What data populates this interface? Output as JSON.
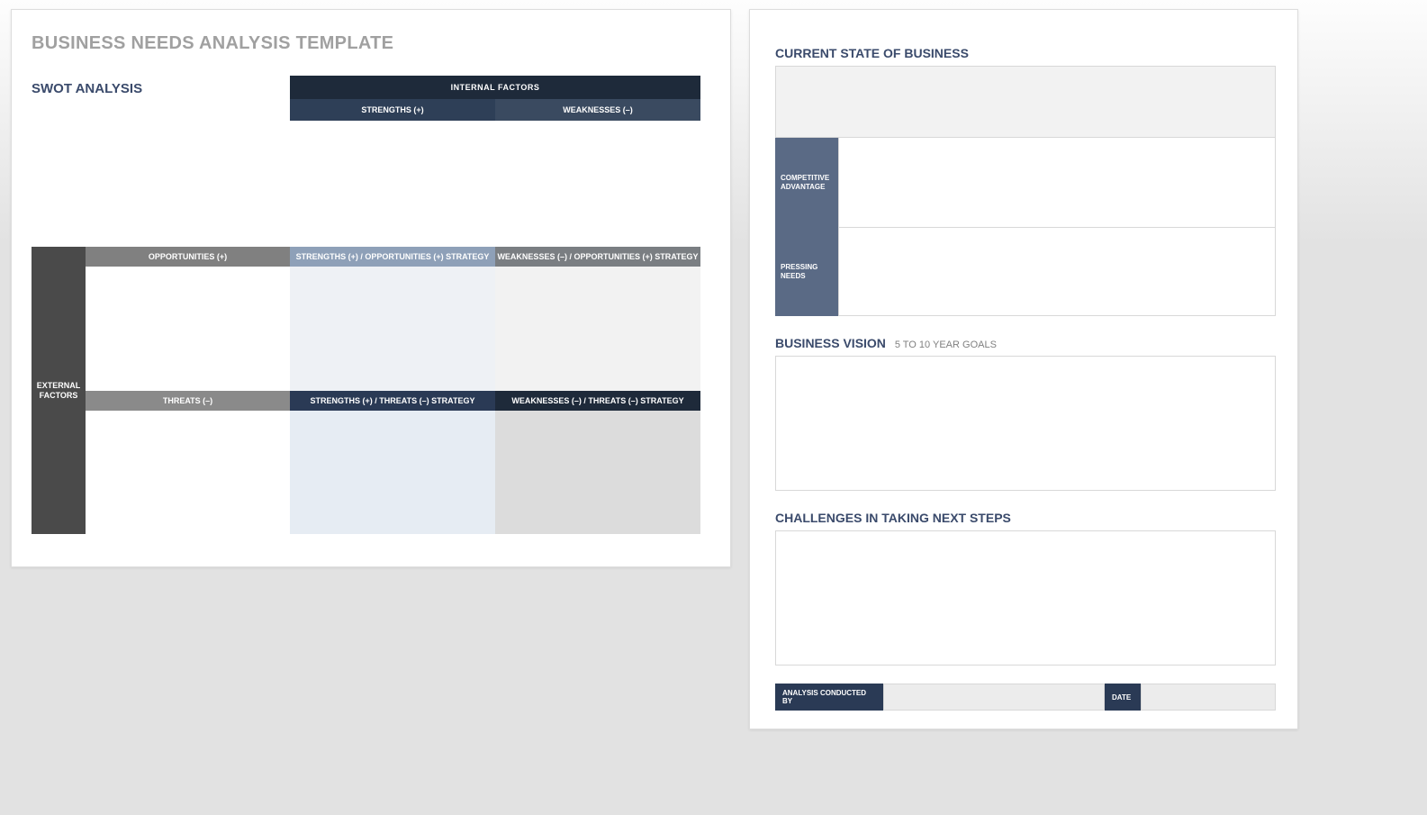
{
  "left": {
    "title": "BUSINESS NEEDS ANALYSIS TEMPLATE",
    "swot_label": "SWOT ANALYSIS",
    "internal_factors": "INTERNAL    FACTORS",
    "external_factors": "EXTERNAL FACTORS",
    "strengths": "STRENGTHS (+)",
    "weaknesses": "WEAKNESSES (–)",
    "opportunities": "OPPORTUNITIES (+)",
    "threats": "THREATS (–)",
    "so_strategy": "STRENGTHS (+) / OPPORTUNITIES (+) STRATEGY",
    "wo_strategy": "WEAKNESSES (–) / OPPORTUNITIES (+) STRATEGY",
    "st_strategy": "STRENGTHS (+) / THREATS (–) STRATEGY",
    "wt_strategy": "WEAKNESSES (–) / THREATS (–) STRATEGY"
  },
  "right": {
    "current_state": "CURRENT STATE OF BUSINESS",
    "competitive_advantage": "COMPETITIVE ADVANTAGE",
    "pressing_needs": "PRESSING NEEDS",
    "business_vision": "BUSINESS VISION",
    "vision_sub": "5 TO 10 YEAR GOALS",
    "challenges": "CHALLENGES IN TAKING NEXT STEPS",
    "analysis_conducted_by": "ANALYSIS CONDUCTED BY",
    "date": "DATE"
  }
}
